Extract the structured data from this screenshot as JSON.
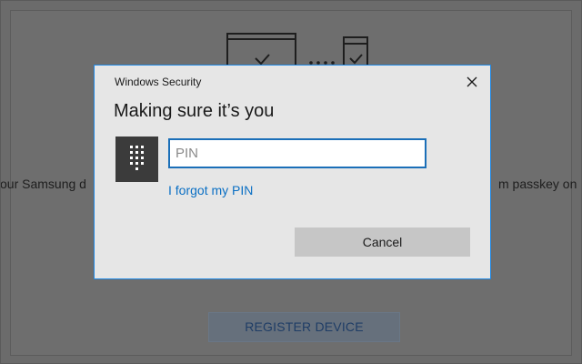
{
  "background": {
    "left_text": "our Samsung d",
    "right_text": "m passkey on",
    "register_button": "REGISTER DEVICE",
    "illustration": [
      "laptop-check-icon",
      "dots-icon",
      "phone-check-icon"
    ]
  },
  "dialog": {
    "window_title": "Windows Security",
    "heading": "Making sure it’s you",
    "pin_placeholder": "PIN",
    "pin_value": "",
    "forgot_link": "I forgot my PIN",
    "cancel_label": "Cancel",
    "icons": {
      "keypad": "keypad-icon",
      "close": "close-icon"
    }
  },
  "colors": {
    "accent": "#1e88e5",
    "link": "#0a6fc4",
    "overlay": "#6b6b6b"
  }
}
